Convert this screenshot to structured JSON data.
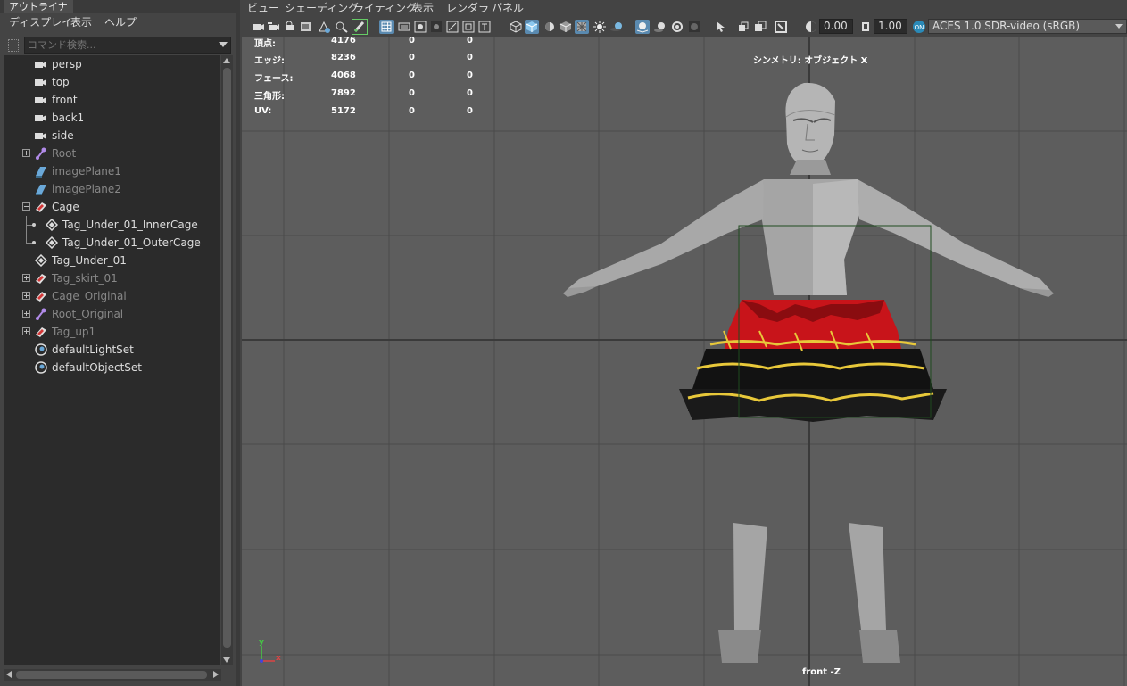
{
  "outliner": {
    "tab_title": "アウトライナ",
    "menu": [
      "ディスプレイ",
      "表示",
      "ヘルプ"
    ],
    "search_placeholder": "コマンド検索...",
    "tree": [
      {
        "label": "persp",
        "icon": "camera-icon"
      },
      {
        "label": "top",
        "icon": "camera-icon"
      },
      {
        "label": "front",
        "icon": "camera-icon"
      },
      {
        "label": "back1",
        "icon": "camera-icon"
      },
      {
        "label": "side",
        "icon": "camera-icon"
      },
      {
        "label": "Root",
        "icon": "joint-icon"
      },
      {
        "label": "imagePlane1",
        "icon": "image-plane-icon"
      },
      {
        "label": "imagePlane2",
        "icon": "image-plane-icon"
      },
      {
        "label": "Cage",
        "icon": "group-icon"
      },
      {
        "label": "Tag_Under_01_InnerCage",
        "icon": "mesh-icon"
      },
      {
        "label": "Tag_Under_01_OuterCage",
        "icon": "mesh-icon"
      },
      {
        "label": "Tag_Under_01",
        "icon": "mesh-icon"
      },
      {
        "label": "Tag_skirt_01",
        "icon": "group-icon"
      },
      {
        "label": "Cage_Original",
        "icon": "group-icon"
      },
      {
        "label": "Root_Original",
        "icon": "joint-icon"
      },
      {
        "label": "Tag_up1",
        "icon": "group-icon"
      },
      {
        "label": "defaultLightSet",
        "icon": "set-icon"
      },
      {
        "label": "defaultObjectSet",
        "icon": "set-icon"
      }
    ]
  },
  "viewport": {
    "menu": [
      "ビュー",
      "シェーディング",
      "ライティング",
      "表示",
      "レンダラ",
      "パネル"
    ],
    "exposure": "0.00",
    "gamma": "1.00",
    "color_space": "ACES 1.0 SDR-video (sRGB)",
    "hud": {
      "rows": [
        {
          "label": "頂点:",
          "v1": "4176",
          "v2": "0",
          "v3": "0"
        },
        {
          "label": "エッジ:",
          "v1": "8236",
          "v2": "0",
          "v3": "0"
        },
        {
          "label": "フェース:",
          "v1": "4068",
          "v2": "0",
          "v3": "0"
        },
        {
          "label": "三角形:",
          "v1": "7892",
          "v2": "0",
          "v3": "0"
        },
        {
          "label": "UV:",
          "v1": "5172",
          "v2": "0",
          "v3": "0"
        }
      ],
      "symmetry": "シンメトリ: オブジェクト X",
      "camera": "front -Z"
    },
    "axis": {
      "y": "y",
      "x": "x"
    },
    "colors": {
      "grid": "#4a4a4a",
      "grid_axis": "#3a3a3a",
      "viewport_bg": "#5d5d5d",
      "skirt_red": "#c8141a",
      "skirt_black": "#121212",
      "skirt_trim": "#e8c83a",
      "selection_box": "#1f4a1f"
    }
  }
}
